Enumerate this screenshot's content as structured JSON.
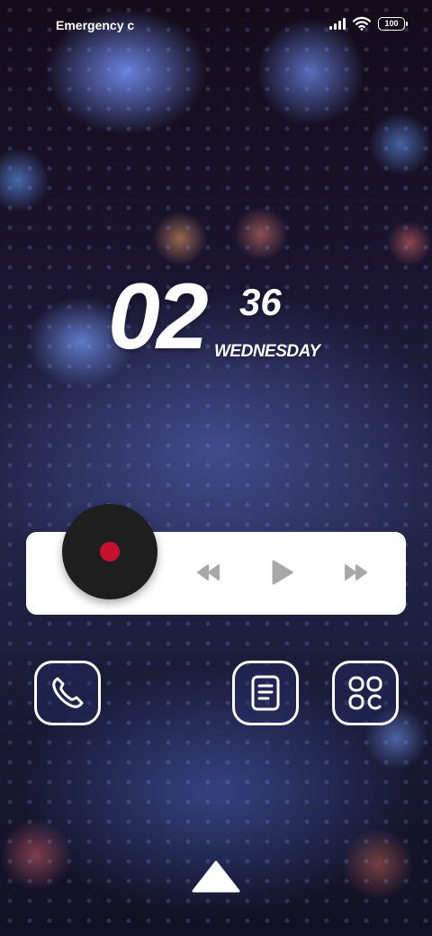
{
  "status_bar": {
    "carrier_text": "Emergency c",
    "signal_icon": "cellular-signal-icon",
    "wifi_icon": "wifi-icon",
    "battery_level": "100"
  },
  "clock": {
    "hour": "02",
    "minute": "36",
    "weekday": "WEDNESDAY"
  },
  "music_widget": {
    "album_icon": "vinyl-disc-icon",
    "controls": [
      "rewind-icon",
      "play-icon",
      "fast-forward-icon"
    ],
    "accent_color": "#c8102e"
  },
  "dock": {
    "apps": [
      "phone-icon",
      "notes-icon",
      "app-drawer-icon"
    ]
  },
  "swipe_hint_icon": "triangle-up-icon"
}
